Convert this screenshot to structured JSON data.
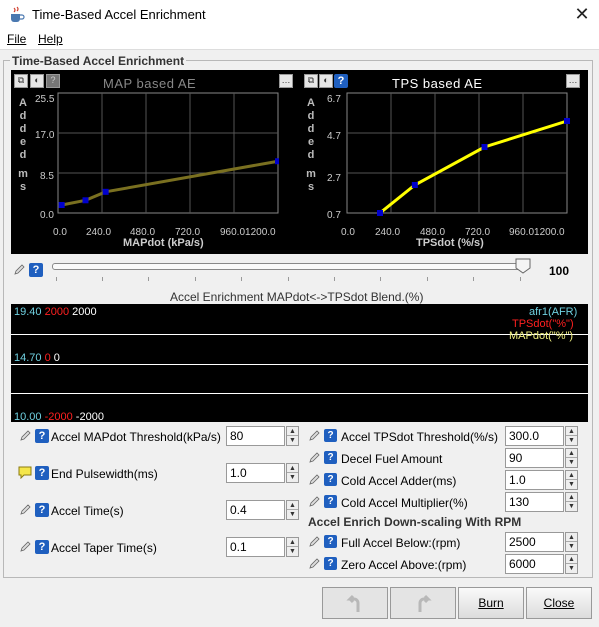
{
  "window": {
    "title": "Time-Based Accel Enrichment",
    "close_glyph": "✕",
    "app_icon": "java-cup-icon"
  },
  "menu": {
    "file": "File",
    "help": "Help"
  },
  "panel": {
    "title": "Time-Based Accel Enrichment"
  },
  "map_chart": {
    "title": "MAP based AE",
    "ylabel_letters": [
      "A",
      "d",
      "d",
      "e",
      "d"
    ],
    "yunit_letters": [
      "m",
      "s"
    ],
    "yticks": [
      "25.5",
      "17.0",
      "8.5",
      "0.0"
    ],
    "xticks": [
      "0.0",
      "240.0",
      "480.0",
      "720.0",
      "960.01200.0"
    ],
    "xlabel": "MAPdot (kPa/s)"
  },
  "tps_chart": {
    "title": "TPS based AE",
    "ylabel_letters": [
      "A",
      "d",
      "d",
      "e",
      "d"
    ],
    "yunit_letters": [
      "m",
      "s"
    ],
    "yticks": [
      "6.7",
      "4.7",
      "2.7",
      "0.7"
    ],
    "xticks": [
      "0.0",
      "240.0",
      "480.0",
      "720.0",
      "960.01200.0"
    ],
    "xlabel": "TPSdot (%/s)"
  },
  "chart_data": [
    {
      "type": "line",
      "title": "MAP based AE",
      "xlabel": "MAPdot (kPa/s)",
      "ylabel": "Added ms",
      "xlim": [
        0,
        1200
      ],
      "ylim": [
        0,
        25.5
      ],
      "x": [
        20,
        150,
        260,
        1200
      ],
      "series": [
        {
          "values": [
            1.7,
            2.7,
            4.5,
            11.0
          ]
        }
      ],
      "color": "#7a7020"
    },
    {
      "type": "line",
      "title": "TPS based AE",
      "xlabel": "TPSdot (%/s)",
      "ylabel": "Added ms",
      "xlim": [
        0,
        1200
      ],
      "ylim": [
        0.7,
        6.7
      ],
      "x": [
        180,
        370,
        750,
        1200
      ],
      "series": [
        {
          "values": [
            0.7,
            2.1,
            4.0,
            5.3
          ]
        }
      ],
      "color": "#ffff00"
    }
  ],
  "slider": {
    "value": "100",
    "fraction": 1.0,
    "caption": "Accel Enrichment MAPdot<->TPSdot Blend.(%)"
  },
  "plot": {
    "top_values": [
      "19.40",
      "2000",
      "2000"
    ],
    "mid_values": [
      "14.70",
      "0",
      "0"
    ],
    "bot_values": [
      "10.00",
      "-2000",
      "-2000"
    ],
    "legend": [
      "afr1(AFR)",
      "TPSdot(\"%\")",
      "MAPdot(\"%\")"
    ]
  },
  "left_fields": [
    {
      "label": "Accel MAPdot Threshold(kPa/s)",
      "value": "80"
    },
    {
      "label": "End Pulsewidth(ms)",
      "value": "1.0"
    },
    {
      "label": "Accel Time(s)",
      "value": "0.4"
    },
    {
      "label": "Accel Taper Time(s)",
      "value": "0.1"
    }
  ],
  "right_fields": [
    {
      "label": "Accel TPSdot Threshold(%/s)",
      "value": "300.0"
    },
    {
      "label": "Decel Fuel Amount",
      "value": "90"
    },
    {
      "label": "Cold Accel Adder(ms)",
      "value": "1.0"
    },
    {
      "label": "Cold Accel Multiplier(%)",
      "value": "130"
    }
  ],
  "downscale": {
    "title": "Accel Enrich Down-scaling With RPM",
    "fields": [
      {
        "label": "Full Accel Below:(rpm)",
        "value": "2500"
      },
      {
        "label": "Zero Accel Above:(rpm)",
        "value": "6000"
      }
    ]
  },
  "buttons": {
    "burn": "Burn",
    "close": "Close"
  },
  "colors": {
    "accent": "#1f5fbf",
    "map_line": "#7a7020",
    "tps_line": "#ffff00",
    "point": "#0000cc"
  }
}
